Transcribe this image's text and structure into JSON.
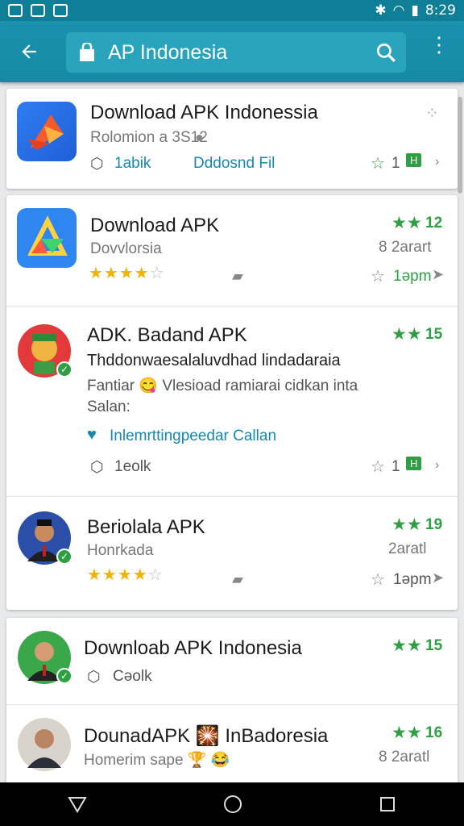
{
  "status": {
    "time": "8:29"
  },
  "toolbar": {
    "title": "AP Indonesia"
  },
  "cards": [
    {
      "name": "Download APK Indonessia",
      "sub": "Rolomion a 3S12",
      "tag": "1abik",
      "action": "Dddosnd Fil",
      "rating": "1"
    }
  ],
  "rows": [
    {
      "name": "Download APK",
      "sub": "Dovvlorsia",
      "rating": "12",
      "size": "8 2arart",
      "time": "1əpm"
    },
    {
      "name": "ADK. Badand APK",
      "desc1": "Thddonwaesalaluvdhad lindadaraia",
      "desc2": "Fantiar 😋 Vlesioad ramiarai cidkan inta",
      "desc3": "Salan:",
      "verified": "Inlemrttingpeedar Callan",
      "rating": "15",
      "tag": "1eolk",
      "count": "1"
    },
    {
      "name": "Beriolala APK",
      "sub": "Honrkada",
      "rating": "19",
      "size": "2aratl",
      "time": "1əpm"
    },
    {
      "name": "Downloab APK Indonesia",
      "tag": "Cəolk",
      "rating": "15"
    },
    {
      "name": "DounadAPK 🎇 InBadoresia",
      "sub": "Homerim sape 🏆 😂",
      "rating": "16",
      "size": "8 2aratl"
    }
  ]
}
